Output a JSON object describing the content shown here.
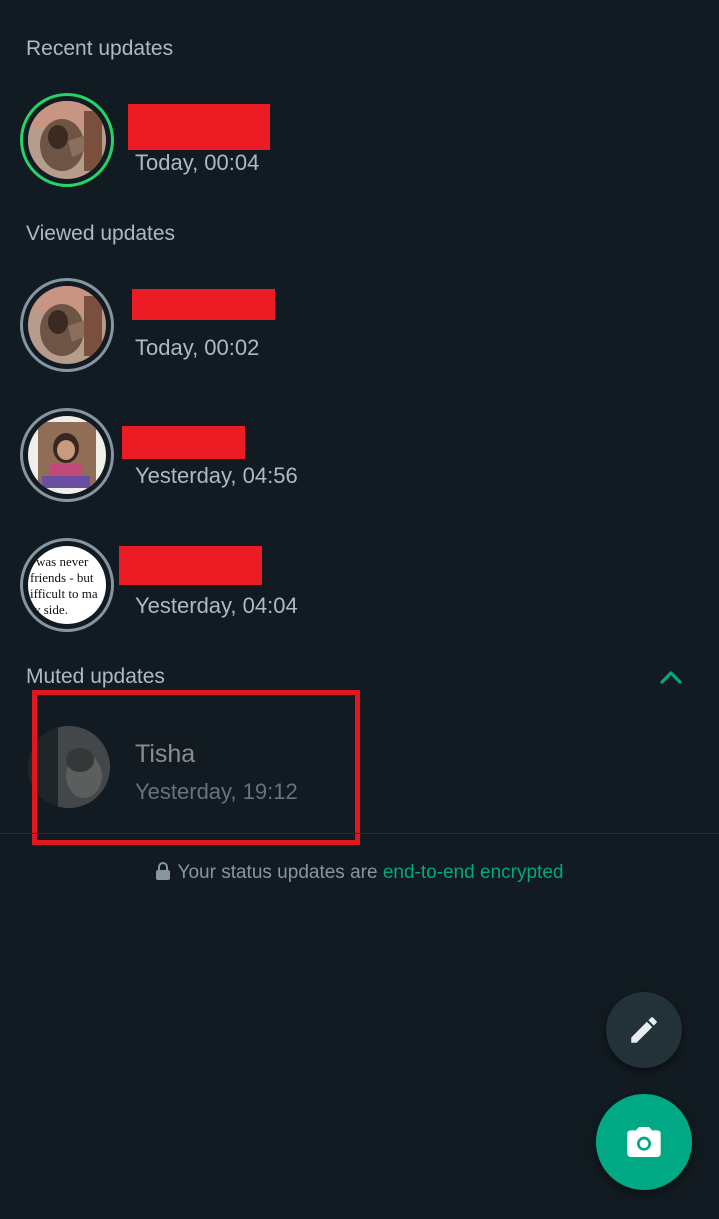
{
  "sections": {
    "recent": "Recent updates",
    "viewed": "Viewed updates",
    "muted": "Muted updates"
  },
  "recent_updates": [
    {
      "time": "Today, 00:04",
      "ring": "green"
    }
  ],
  "viewed_updates": [
    {
      "time": "Today, 00:02",
      "ring": "grey"
    },
    {
      "time": "Yesterday, 04:56",
      "ring": "grey"
    },
    {
      "time": "Yesterday, 04:04",
      "ring": "grey",
      "thumb_text": [
        "was never",
        "friends - but",
        "ifficult to ma",
        "y side."
      ]
    }
  ],
  "muted_updates": [
    {
      "name": "Tisha",
      "time": "Yesterday, 19:12"
    }
  ],
  "footer": {
    "text": "Your status updates are ",
    "link": "end-to-end encrypted"
  },
  "colors": {
    "background": "#111b21",
    "accent": "#00a884",
    "unviewed_ring": "#25d366",
    "viewed_ring": "#8696a0",
    "redaction": "#ed1c24",
    "highlight_box": "#e2161f"
  },
  "icons": {
    "chevron": "chevron-up-icon",
    "lock": "lock-icon",
    "pencil": "pencil-icon",
    "camera": "camera-icon"
  }
}
